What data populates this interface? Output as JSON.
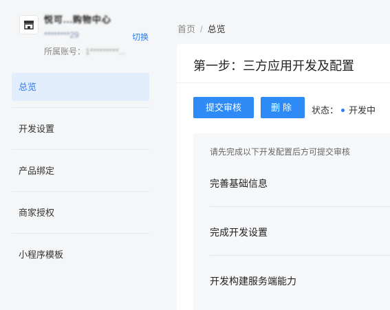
{
  "account": {
    "name": "悦可...购物中心",
    "sub_id": "********29",
    "switch_label": "切换",
    "owner_label": "所属账号：",
    "owner_value": "1*********..."
  },
  "sidebar": {
    "items": [
      {
        "label": "总览",
        "active": true
      },
      {
        "label": "开发设置",
        "active": false
      },
      {
        "label": "产品绑定",
        "active": false
      },
      {
        "label": "商家授权",
        "active": false
      },
      {
        "label": "小程序模板",
        "active": false
      }
    ]
  },
  "breadcrumb": {
    "home": "首页",
    "separator": "/",
    "current": "总览"
  },
  "main": {
    "step_title": "第一步：三方应用开发及配置",
    "submit_label": "提交审核",
    "delete_label": "删除",
    "status_label": "状态：",
    "status_value": "开发中",
    "hint": "请先完成以下开发配置后方可提交审核",
    "steps": [
      {
        "label": "完善基础信息"
      },
      {
        "label": "完成开发设置"
      },
      {
        "label": "开发构建服务端能力"
      }
    ]
  },
  "colors": {
    "accent": "#2e7cf6",
    "active_bg": "#e3eefc",
    "page_bg": "#f5f6f7"
  }
}
